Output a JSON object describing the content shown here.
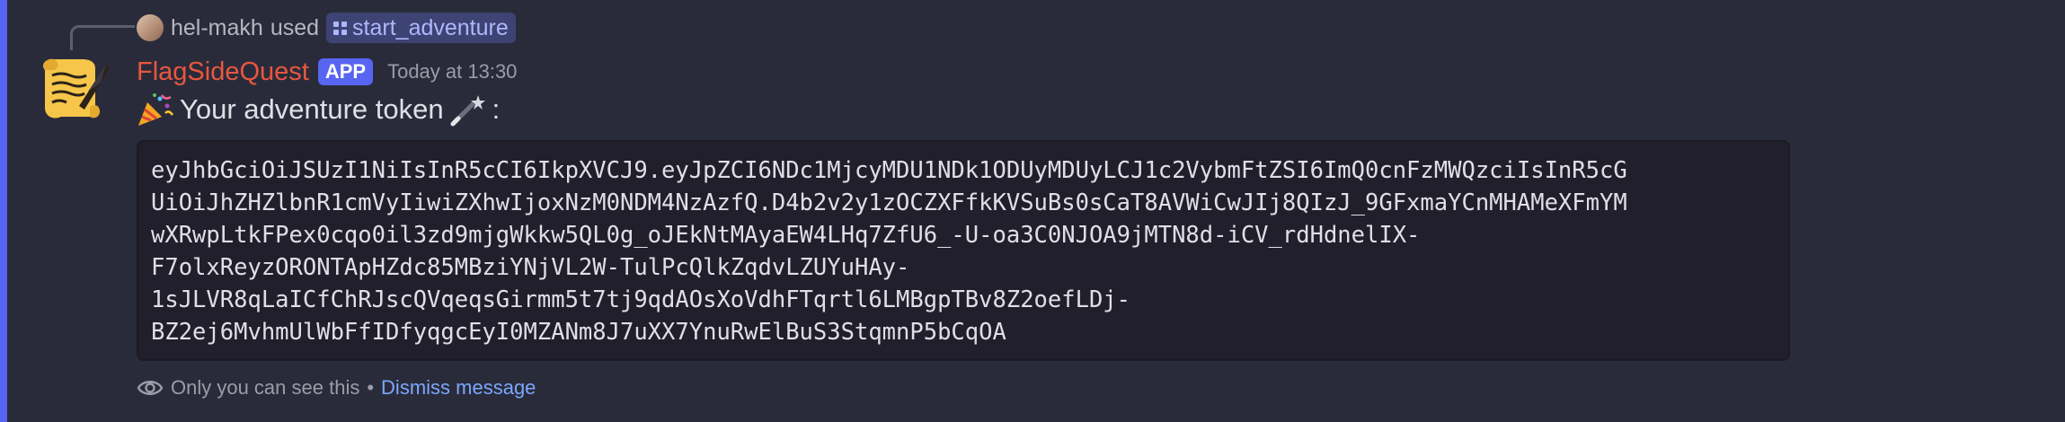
{
  "reply": {
    "username": "hel-makh",
    "used_text": "used",
    "command": "start_adventure"
  },
  "message": {
    "bot_name": "FlagSideQuest",
    "badge": "APP",
    "timestamp": "Today at 13:30",
    "content_text": "Your adventure token",
    "content_suffix": ":",
    "token_lines": [
      "eyJhbGciOiJSUzI1NiIsInR5cCI6IkpXVCJ9.eyJpZCI6NDc1MjcyMDU1NDk1ODUyMDUyLCJ1c2VybmFtZSI6ImQ0cnFzMWQzciIsInR5cG",
      "UiOiJhZHZlbnR1cmVyIiwiZXhwIjoxNzM0NDM4NzAzfQ.D4b2v2y1zOCZXFfkKVSuBs0sCaT8AVWiCwJIj8QIzJ_9GFxmaYCnMHAMeXFmYM",
      "wXRwpLtkFPex0cqo0il3zd9mjgWkkw5QL0g_oJEkNtMAyaEW4LHq7ZfU6_-U-oa3C0NJOA9jMTN8d-iCV_rdHdnelIX-",
      "F7olxReyzORONTApHZdc85MBziYNjVL2W-TulPcQlkZqdvLZUYuHAy-",
      "1sJLVR8qLaICfChRJscQVqeqsGirmm5t7tj9qdAOsXoVdhFTqrtl6LMBgpTBv8Z2oefLDj-",
      "BZ2ej6MvhmUlWbFfIDfyqgcEyI0MZANm8J7uXX7YnuRwElBuS3StqmnP5bCqOA"
    ]
  },
  "ephemeral": {
    "notice": "Only you can see this",
    "separator": "•",
    "dismiss": "Dismiss message"
  },
  "colors": {
    "background": "#2a2b3a",
    "accent_bar": "#5865f2",
    "bot_name": "#e8573e",
    "app_badge": "#5865f2",
    "link": "#7ba7ff",
    "code_background": "#221f2c"
  },
  "icons": {
    "party": "party-popper-icon",
    "wand": "magic-wand-icon",
    "eye": "eye-icon",
    "command": "slash-command-icon",
    "avatar": "scroll-quill-avatar"
  }
}
